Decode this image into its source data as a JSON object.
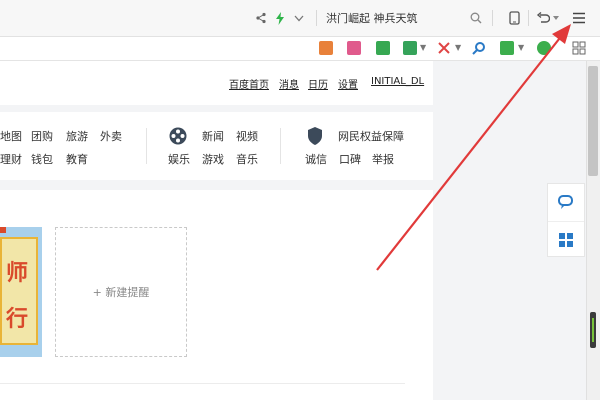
{
  "toolbar": {
    "hot_news": "洪门崛起 神兵天筑",
    "icons": [
      "share-icon",
      "lightning-icon",
      "chevron-down-icon",
      "search-icon",
      "tablet-icon",
      "undo-icon",
      "menu-icon"
    ]
  },
  "extensions": [
    "tv-icon",
    "bookmark-icon",
    "book-icon",
    "add-icon",
    "scissors-icon",
    "search-icon",
    "gamepad-icon",
    "shield-icon",
    "apps-icon"
  ],
  "top_nav": {
    "links": [
      "百度首页",
      "消息",
      "日历",
      "设置",
      "INITIAL_DL"
    ]
  },
  "categories": {
    "group1": [
      "地图",
      "团购",
      "旅游",
      "外卖",
      "理财",
      "钱包",
      "教育"
    ],
    "group2": [
      "新闻",
      "视频",
      "娱乐",
      "游戏",
      "音乐"
    ],
    "group3_title": "网民权益保障",
    "group3": [
      "诚信",
      "口碑",
      "举报"
    ]
  },
  "thumb_chars": [
    "师",
    "行"
  ],
  "new_reminder": "+ 新建提醒",
  "colors": {
    "accent_green": "#2fb44a",
    "arrow_red": "#e13a3a",
    "link_blue": "#2a7ac6"
  }
}
